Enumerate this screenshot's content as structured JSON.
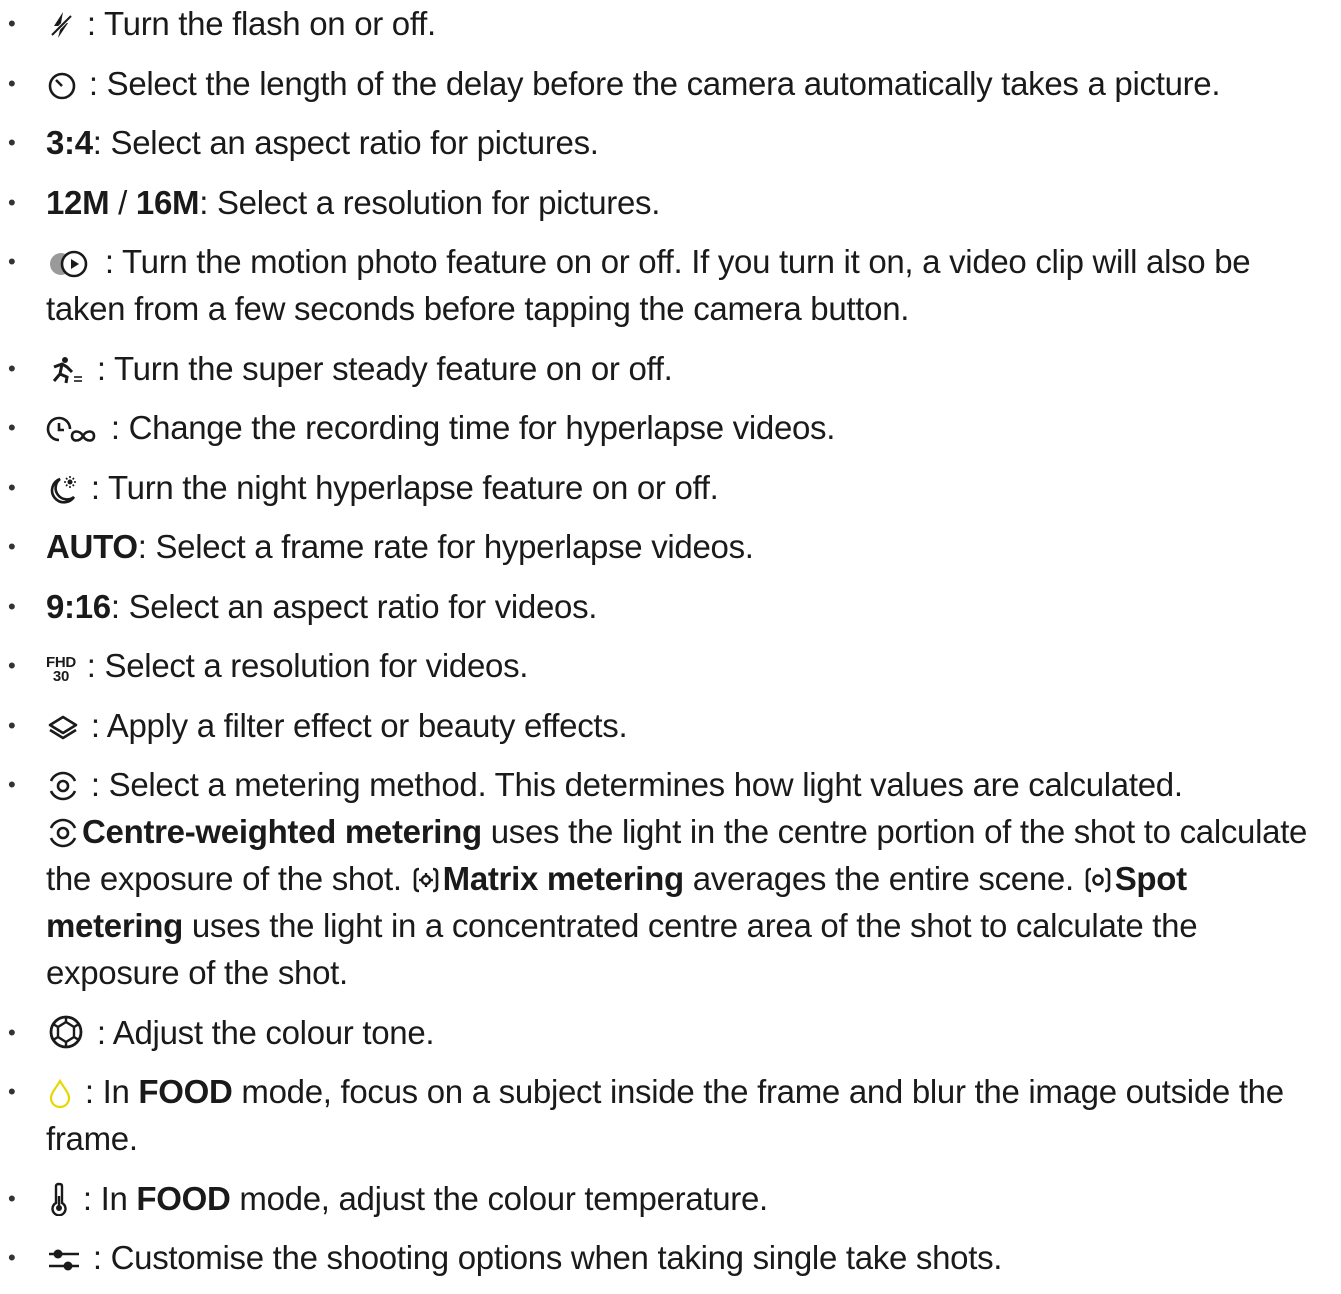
{
  "items": [
    {
      "icon": "flash-off-icon",
      "text": " : Turn the flash on or off."
    },
    {
      "icon": "timer-icon",
      "text": " : Select the length of the delay before the camera automatically takes a picture."
    },
    {
      "bold": "3:4",
      "text": ": Select an aspect ratio for pictures."
    },
    {
      "bold": "12M",
      "sep": " / ",
      "bold2": "16M",
      "text": ": Select a resolution for pictures."
    },
    {
      "icon": "motion-photo-icon",
      "text": " : Turn the motion photo feature on or off. If you turn it on, a video clip will also be taken from a few seconds before tapping the camera button."
    },
    {
      "icon": "super-steady-icon",
      "text": " : Turn the super steady feature on or off."
    },
    {
      "icon": "hyperlapse-time-icon",
      "text": " : Change the recording time for hyperlapse videos."
    },
    {
      "icon": "night-hyperlapse-icon",
      "text": " : Turn the night hyperlapse feature on or off."
    },
    {
      "bold": "AUTO",
      "text": ": Select a frame rate for hyperlapse videos."
    },
    {
      "bold": "9:16",
      "text": ": Select an aspect ratio for videos."
    },
    {
      "icon": "fhd-30-icon",
      "icon_text_top": "FHD",
      "icon_text_bottom": "30",
      "text": " : Select a resolution for videos."
    },
    {
      "icon": "filter-layers-icon",
      "text": " : Apply a filter effect or beauty effects."
    },
    {
      "icon": "metering-icon",
      "text": " : Select a metering method. This determines how light values are calculated.",
      "centre_label": "Centre-weighted metering",
      "centre_text": " uses the light in the centre portion of the shot to calculate the exposure of the shot.",
      "matrix_label": "Matrix metering",
      "matrix_text": " averages the entire scene.",
      "spot_label": "Spot metering",
      "spot_text": " uses the light in a concentrated centre area of the shot to calculate the exposure of the shot."
    },
    {
      "icon": "colour-tone-icon",
      "text": " : Adjust the colour tone."
    },
    {
      "icon": "food-focus-icon",
      "pre": " : In ",
      "bold": "FOOD",
      "text": " mode, focus on a subject inside the frame and blur the image outside the frame."
    },
    {
      "icon": "thermometer-icon",
      "pre": " : In ",
      "bold": "FOOD",
      "text": " mode, adjust the colour temperature."
    },
    {
      "icon": "sliders-icon",
      "text": " : Customise the shooting options when taking single take shots."
    }
  ],
  "colors": {
    "text": "#1a1a1a",
    "food_icon": "#e8d600"
  }
}
